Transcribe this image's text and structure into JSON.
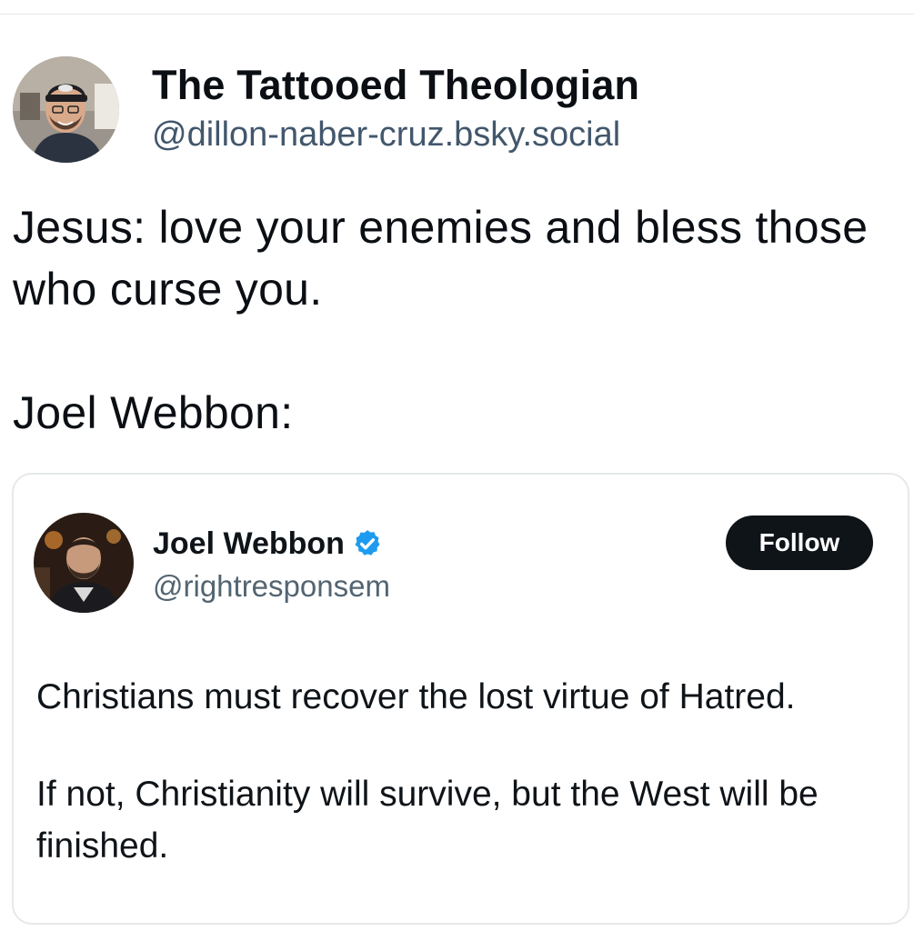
{
  "post": {
    "author": {
      "display_name": "The Tattooed Theologian",
      "handle": "@dillon-naber-cruz.bsky.social",
      "avatar_icon": "user-avatar-photo"
    },
    "text_lines": [
      "Jesus: love your enemies and bless those who curse you.",
      "Joel Webbon:"
    ]
  },
  "quoted_post": {
    "author": {
      "display_name": "Joel Webbon",
      "handle": "@rightresponsem",
      "verified": true,
      "verified_icon": "verified-badge-icon",
      "avatar_icon": "user-avatar-photo"
    },
    "follow_label": "Follow",
    "paragraphs": [
      "Christians must recover the lost virtue of Hatred.",
      "If not, Christianity will survive, but the West will be finished."
    ]
  },
  "colors": {
    "handle": "#42576c",
    "verified_badge": "#1d9bf0",
    "follow_button_bg": "#0f1419",
    "border": "#e6e8eb"
  }
}
